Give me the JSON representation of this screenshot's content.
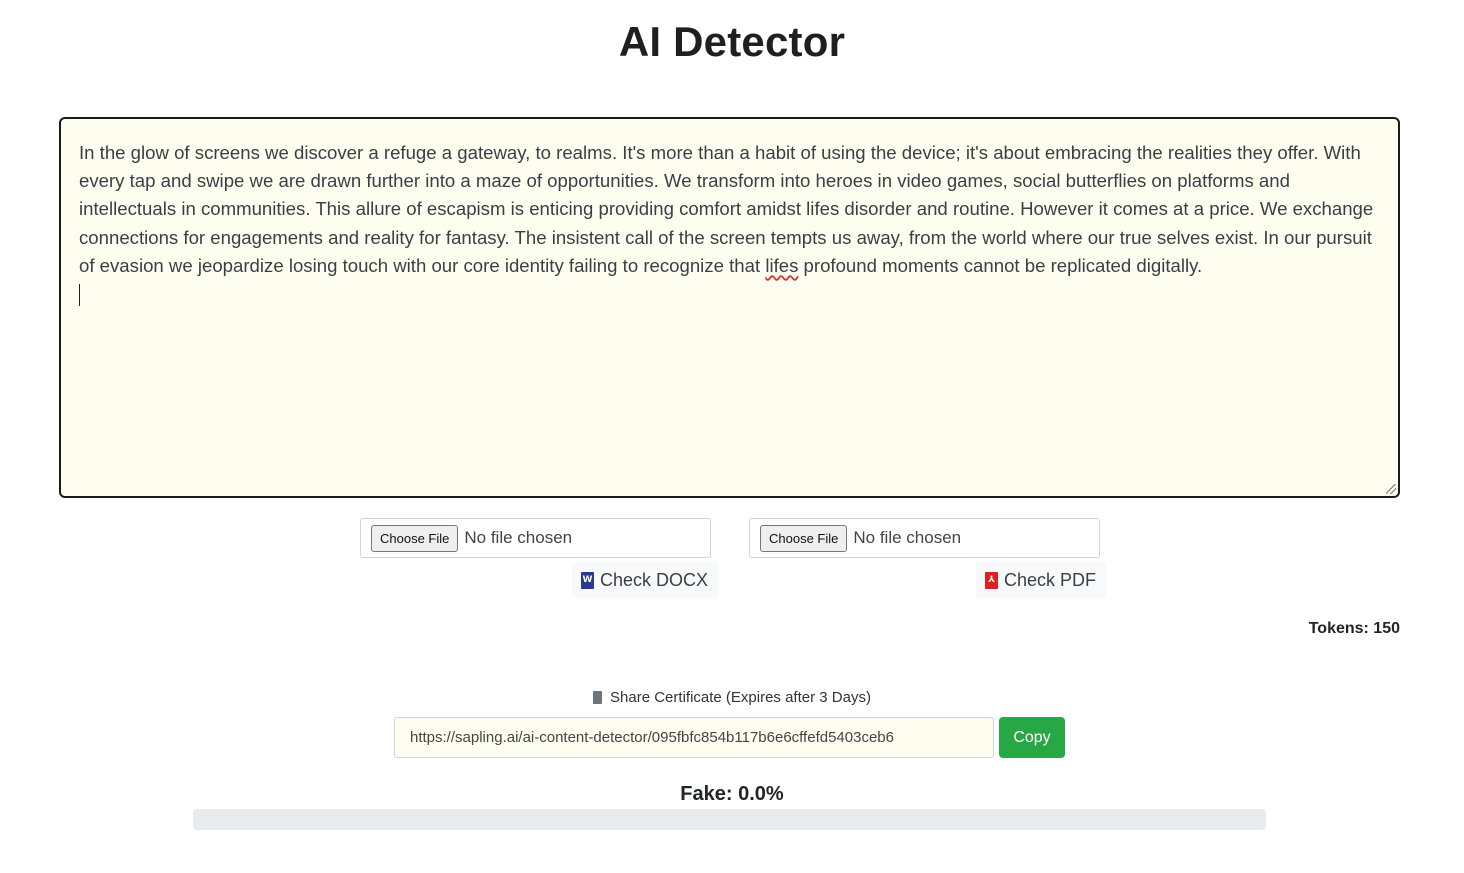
{
  "header": {
    "title": "AI Detector"
  },
  "editor": {
    "text_before": "In the glow of screens we discover a refuge a gateway, to realms. It's more than a habit of using the device; it's about embracing the realities they offer. With every tap and swipe we are drawn further into a maze of opportunities. We transform into heroes in video games, social butterflies on platforms and intellectuals in communities. This allure of escapism is enticing providing comfort amidst lifes disorder and routine. However it comes at a price. We exchange connections for engagements and reality for fantasy. The insistent call of the screen tempts us away, from the world where our true selves exist. In our pursuit of evasion we jeopardize losing touch with our core identity failing to recognize that ",
    "misspelled_word": "lifes",
    "text_after": " profound moments cannot be replicated digitally."
  },
  "uploads": {
    "docx": {
      "choose_label": "Choose File",
      "status": "No file chosen",
      "check_label": "Check DOCX",
      "icon": "word-file-icon"
    },
    "pdf": {
      "choose_label": "Choose File",
      "status": "No file chosen",
      "check_label": "Check PDF",
      "icon": "pdf-file-icon"
    }
  },
  "stats": {
    "tokens_label": "Tokens: 150"
  },
  "share": {
    "icon": "receipt-icon",
    "label": "Share Certificate (Expires after 3 Days)",
    "url": "https://sapling.ai/ai-content-detector/095fbfc854b117b6e6cffefd5403ceb6",
    "copy_label": "Copy"
  },
  "result": {
    "fake_label": "Fake: 0.0%",
    "fake_fraction": 0.0
  },
  "colors": {
    "editor_bg": "#fefef0",
    "copy_button": "#28a745",
    "progress_track": "#e9ecef",
    "word_icon": "#2b3a8f",
    "pdf_icon": "#e02020"
  }
}
